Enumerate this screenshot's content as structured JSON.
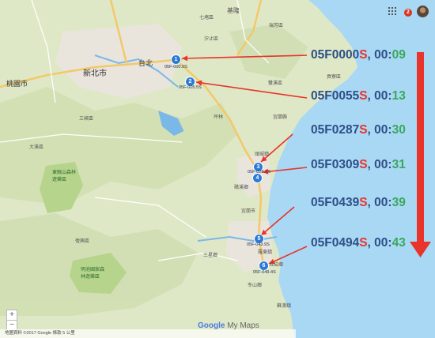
{
  "colors": {
    "sea": "#a9d8f5",
    "land_base": "#dfe8c6",
    "terrain": "#c9d8a6",
    "park": "#b6d48c",
    "urban": "#e9e5dc",
    "river": "#7ab8e8",
    "highway": "#f3c86a",
    "road": "#ffffff",
    "trajectory_arrow": "#e8342a",
    "marker": "#2b7bd6",
    "time_prefix": "#2f4f86",
    "time_s": "#e8342a",
    "time_seconds": "#3aa85a"
  },
  "annotations": [
    {
      "tile": "05F",
      "num": "0000",
      "suffix": "S",
      "sep": ", ",
      "mm": "00:",
      "ss": "09"
    },
    {
      "tile": "05F",
      "num": "0055",
      "suffix": "S",
      "sep": ", ",
      "mm": "00:",
      "ss": "13"
    },
    {
      "tile": "05F",
      "num": "0287",
      "suffix": "S",
      "sep": ", ",
      "mm": "00:",
      "ss": "30"
    },
    {
      "tile": "05F",
      "num": "0309",
      "suffix": "S",
      "sep": ", ",
      "mm": "00:",
      "ss": "31"
    },
    {
      "tile": "05F",
      "num": "0439",
      "suffix": "S",
      "sep": ", ",
      "mm": "00:",
      "ss": "39"
    },
    {
      "tile": "05F",
      "num": "0494",
      "suffix": "S",
      "sep": ", ",
      "mm": "00:",
      "ss": "43"
    }
  ],
  "markers": [
    {
      "n": "1",
      "label": "05F-000.0S"
    },
    {
      "n": "2",
      "label": "05F-005.5S"
    },
    {
      "n": "3",
      "label": "05F-028.7S"
    },
    {
      "n": "4",
      "label": ""
    },
    {
      "n": "5",
      "label": "05F-043.9S"
    },
    {
      "n": "6",
      "label": "05F-049.4S"
    }
  ],
  "cities": {
    "taibei": "台北",
    "xinbei": "新北市",
    "taoyuan": "桃園市"
  },
  "places": [
    "基隆",
    "七堵區",
    "瑞芳區",
    "汐止區",
    "雙溪區",
    "貢寮區",
    "宜蘭縣",
    "坪林",
    "三峽區",
    "大溪區",
    "礁溪鄉",
    "宜蘭市",
    "頭城鎮",
    "羅東鎮",
    "冬山鄉",
    "蘇澳鎮",
    "三星鄉",
    "復興區",
    "五結鄉"
  ],
  "park_labels": [
    "東眼山森林遊樂區",
    "明池國家森林遊樂區"
  ],
  "controls": {
    "notification_count": "2",
    "zoom_in": "+",
    "zoom_out": "−"
  },
  "branding": {
    "google": "Google",
    "mymaps": " My Maps"
  },
  "footer": {
    "text": "地圖資料 ©2017 Google   條款   5 公里 "
  }
}
